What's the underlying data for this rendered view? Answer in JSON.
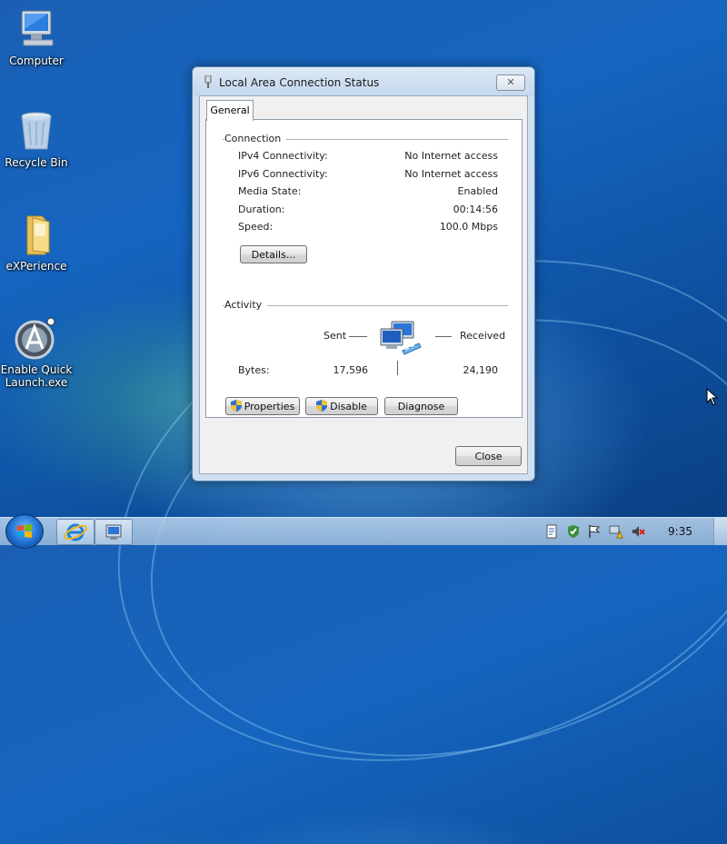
{
  "desktop": {
    "icons": [
      {
        "label": "Computer",
        "icon": "computer-icon"
      },
      {
        "label": "Recycle Bin",
        "icon": "recycle-bin-icon"
      },
      {
        "label": "eXPerience",
        "icon": "folder-icon"
      },
      {
        "label": "Enable Quick Launch.exe",
        "icon": "app-icon"
      }
    ]
  },
  "dialog": {
    "title": "Local Area Connection Status",
    "close_label": "✕",
    "tab_label": "General",
    "connection": {
      "group_title": "Connection",
      "rows": [
        {
          "label": "IPv4 Connectivity:",
          "value": "No Internet access"
        },
        {
          "label": "IPv6 Connectivity:",
          "value": "No Internet access"
        },
        {
          "label": "Media State:",
          "value": "Enabled"
        },
        {
          "label": "Duration:",
          "value": "00:14:56"
        },
        {
          "label": "Speed:",
          "value": "100.0 Mbps"
        }
      ],
      "details_button": "Details..."
    },
    "activity": {
      "group_title": "Activity",
      "sent_label": "Sent",
      "received_label": "Received",
      "bytes_label": "Bytes:",
      "bytes_sent": "17,596",
      "bytes_received": "24,190"
    },
    "buttons": {
      "properties": "Properties",
      "disable": "Disable",
      "diagnose": "Diagnose",
      "close": "Close"
    }
  },
  "taskbar": {
    "clock": "9:35"
  },
  "colors": {
    "desktop_blue": "#1565c0",
    "dialog_frame": "#cfe0f1"
  }
}
